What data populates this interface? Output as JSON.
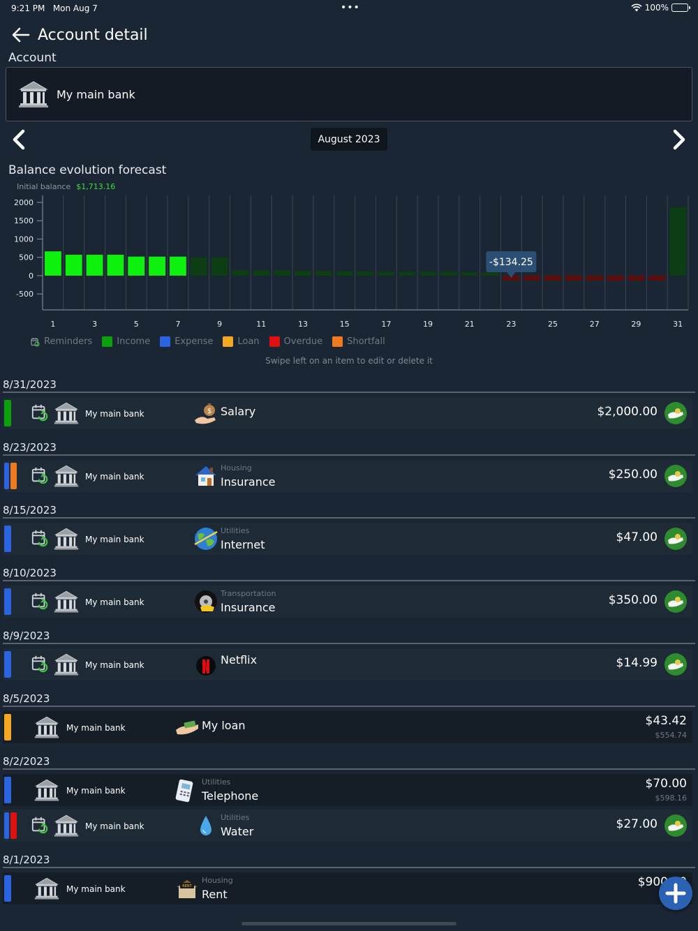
{
  "status_bar": {
    "time": "9:21 PM",
    "date": "Mon Aug 7",
    "dots": "•••",
    "battery": "100%"
  },
  "header": {
    "title": "Account detail"
  },
  "account": {
    "label": "Account",
    "name": "My main bank"
  },
  "month_nav": {
    "month": "August 2023"
  },
  "chart_section": {
    "title": "Balance evolution forecast",
    "initial_balance_label": "Initial balance",
    "initial_balance_value": "$1,713.16"
  },
  "chart_data": {
    "type": "bar",
    "x": [
      1,
      2,
      3,
      4,
      5,
      6,
      7,
      8,
      9,
      10,
      11,
      12,
      13,
      14,
      15,
      16,
      17,
      18,
      19,
      20,
      21,
      22,
      23,
      24,
      25,
      26,
      27,
      28,
      29,
      30,
      31
    ],
    "x_tick_labels": [
      "1",
      "3",
      "5",
      "7",
      "9",
      "11",
      "13",
      "15",
      "17",
      "19",
      "21",
      "23",
      "25",
      "27",
      "29",
      "31"
    ],
    "values": [
      663,
      570,
      570,
      570,
      520,
      520,
      520,
      500,
      500,
      150,
      150,
      150,
      135,
      135,
      120,
      120,
      105,
      105,
      105,
      105,
      90,
      90,
      -134.25,
      -134.25,
      -134.25,
      -134.25,
      -134.25,
      -134.25,
      -134.25,
      -134.25,
      1865.75
    ],
    "bar_colors": [
      "#0ef00e",
      "#0ef00e",
      "#0ef00e",
      "#0ef00e",
      "#0ef00e",
      "#0ef00e",
      "#0ef00e",
      "#0d3d12",
      "#0d3d12",
      "#0d3d12",
      "#0d3d12",
      "#0d3d12",
      "#0d3d12",
      "#0d3d12",
      "#0d3d12",
      "#0d3d12",
      "#0d3d12",
      "#0d3d12",
      "#0d3d12",
      "#0d3d12",
      "#0d3d12",
      "#0d3d12",
      "#5e0d0d",
      "#5e0d0d",
      "#5e0d0d",
      "#5e0d0d",
      "#5e0d0d",
      "#5e0d0d",
      "#5e0d0d",
      "#5e0d0d",
      "#0d3d12"
    ],
    "y_ticks": [
      -500,
      0,
      500,
      1000,
      1500,
      2000
    ],
    "ylim": [
      -500,
      2000
    ],
    "xlim": [
      1,
      31
    ],
    "grid": true,
    "tooltip": {
      "day": 23,
      "text": "-$134.25"
    }
  },
  "legend": [
    {
      "label": "Reminders",
      "icon": "calendar-refresh-icon"
    },
    {
      "label": "Income",
      "color": "#0ca10c"
    },
    {
      "label": "Expense",
      "color": "#2b63e0"
    },
    {
      "label": "Loan",
      "color": "#f5a623"
    },
    {
      "label": "Overdue",
      "color": "#e01010"
    },
    {
      "label": "Shortfall",
      "color": "#f07a1e"
    }
  ],
  "hint": "Swipe left on an item to edit or delete it",
  "dates": [
    "8/31/2023",
    "8/23/2023",
    "8/15/2023",
    "8/10/2023",
    "8/9/2023",
    "8/5/2023",
    "8/2/2023",
    "8/1/2023"
  ],
  "transactions": [
    {
      "bank": "My main bank",
      "category": "",
      "payee": "Salary",
      "amount": "$2,000.00",
      "sub_amount": "",
      "icon": "money-bag-hand-icon"
    },
    {
      "bank": "My main bank",
      "category": "Housing",
      "payee": "Insurance",
      "amount": "$250.00",
      "sub_amount": "",
      "icon": "house-icon"
    },
    {
      "bank": "My main bank",
      "category": "Utilities",
      "payee": "Internet",
      "amount": "$47.00",
      "sub_amount": "",
      "icon": "globe-icon"
    },
    {
      "bank": "My main bank",
      "category": "Transportation",
      "payee": "Insurance",
      "amount": "$350.00",
      "sub_amount": "",
      "icon": "car-wheel-icon"
    },
    {
      "bank": "My main bank",
      "category": "",
      "payee": "Netflix",
      "amount": "$14.99",
      "sub_amount": "",
      "icon": "netflix-icon"
    },
    {
      "bank": "My main bank",
      "category": "",
      "payee": "My loan",
      "amount": "$43.42",
      "sub_amount": "$554.74",
      "icon": "loan-hand-icon"
    },
    {
      "bank": "My main bank",
      "category": "Utilities",
      "payee": "Telephone",
      "amount": "$70.00",
      "sub_amount": "$598.16",
      "icon": "telephone-icon"
    },
    {
      "bank": "My main bank",
      "category": "Utilities",
      "payee": "Water",
      "amount": "$27.00",
      "sub_amount": "",
      "icon": "water-drop-icon"
    },
    {
      "bank": "My main bank",
      "category": "Housing",
      "payee": "Rent",
      "amount": "$900.00",
      "sub_amount": "",
      "icon": "for-rent-icon"
    }
  ],
  "colors": {
    "income": "#0ca10c",
    "expense": "#2b63e0",
    "loan": "#f5a623",
    "overdue": "#e01010",
    "shortfall": "#f07a1e",
    "pay": "#2e8b2e",
    "fab": "#2c62b3"
  }
}
